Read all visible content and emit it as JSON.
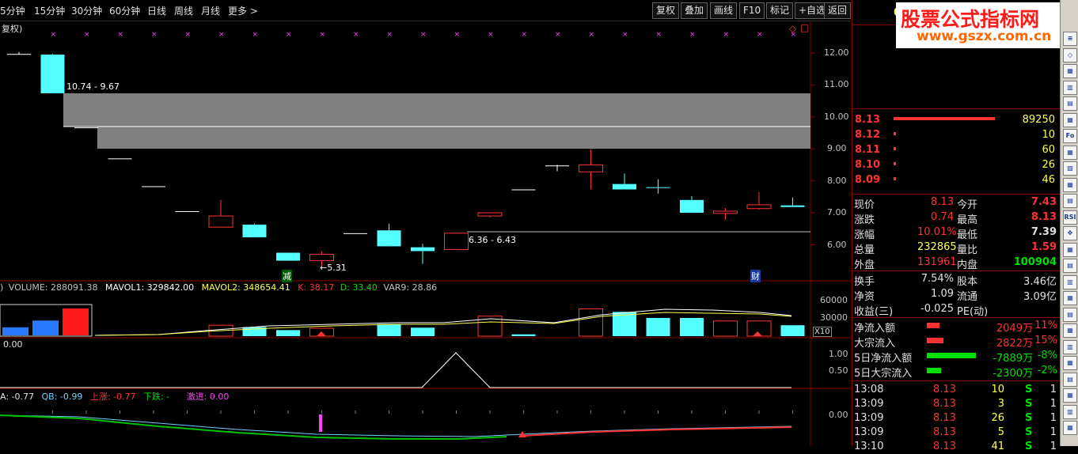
{
  "toolbar": {
    "periods": [
      "5分钟",
      "15分钟",
      "30分钟",
      "60分钟",
      "日线",
      "周线",
      "月线",
      "更多 >"
    ],
    "buttons": [
      "复权",
      "叠加",
      "画线",
      "F10",
      "标记",
      "+自选",
      "返回"
    ]
  },
  "chart": {
    "mode_label": "复权)",
    "price_axis": [
      "12.00",
      "11.00",
      "10.00",
      "9.00",
      "8.00",
      "7.00",
      "6.00"
    ],
    "annotations": {
      "zone_top": "10.74 - 9.67",
      "zone_low": "6.36 - 6.43",
      "low_mark": "←5.31",
      "tag_jian": "减",
      "tag_cai": "财"
    },
    "colors": {
      "up": "#ff3232",
      "down": "#54ffff",
      "zone": "#808080"
    },
    "candles": [
      {
        "o": 11.97,
        "c": 11.97,
        "h": 12.03,
        "l": 11.95
      },
      {
        "o": 11.95,
        "c": 10.74,
        "h": 11.97,
        "l": 10.74
      },
      {
        "o": 9.67,
        "c": 9.67,
        "h": 9.67,
        "l": 9.67
      },
      {
        "o": 8.7,
        "c": 8.7,
        "h": 8.7,
        "l": 8.7
      },
      {
        "o": 7.83,
        "c": 7.83,
        "h": 7.83,
        "l": 7.83
      },
      {
        "o": 7.05,
        "c": 7.05,
        "h": 7.05,
        "l": 7.05
      },
      {
        "o": 6.55,
        "c": 6.9,
        "h": 7.4,
        "l": 6.55
      },
      {
        "o": 6.63,
        "c": 6.23,
        "h": 6.66,
        "l": 6.23
      },
      {
        "o": 5.75,
        "c": 5.5,
        "h": 5.75,
        "l": 5.5
      },
      {
        "o": 5.5,
        "c": 5.7,
        "h": 5.8,
        "l": 5.31
      },
      {
        "o": 6.36,
        "c": 6.36,
        "h": 6.36,
        "l": 6.36
      },
      {
        "o": 6.45,
        "c": 5.95,
        "h": 6.66,
        "l": 5.95
      },
      {
        "o": 5.92,
        "c": 5.8,
        "h": 6.03,
        "l": 5.4
      },
      {
        "o": 5.85,
        "c": 6.36,
        "h": 6.36,
        "l": 5.85
      },
      {
        "o": 6.9,
        "c": 7.0,
        "h": 7.0,
        "l": 6.85
      },
      {
        "o": 7.73,
        "c": 7.73,
        "h": 7.73,
        "l": 7.73
      },
      {
        "o": 8.48,
        "c": 8.48,
        "h": 8.5,
        "l": 8.3
      },
      {
        "o": 8.28,
        "c": 8.5,
        "h": 8.98,
        "l": 7.73
      },
      {
        "o": 7.9,
        "c": 7.73,
        "h": 8.23,
        "l": 7.73
      },
      {
        "o": 7.8,
        "c": 7.78,
        "h": 8.05,
        "l": 7.6
      },
      {
        "o": 7.4,
        "c": 7.0,
        "h": 7.52,
        "l": 7.0
      },
      {
        "o": 6.98,
        "c": 7.05,
        "h": 7.15,
        "l": 6.78
      },
      {
        "o": 7.13,
        "c": 7.25,
        "h": 7.65,
        "l": 7.1
      },
      {
        "o": 7.23,
        "c": 7.18,
        "h": 7.48,
        "l": 7.18
      }
    ]
  },
  "volume": {
    "header": {
      "prefix": ")",
      "vol": "VOLUME: 288091.38",
      "mavol1": "MAVOL1: 329842.00",
      "mavol2": "MAVOL2: 348654.41",
      "k": "K: 38.17",
      "d": "D: 33.40",
      "var9": "VAR9: 28.86"
    },
    "axis": [
      "60000",
      "30000"
    ],
    "x10": "X10",
    "bars": [
      0,
      0,
      0,
      0,
      0,
      0,
      18000,
      15000,
      10000,
      13000,
      0,
      20000,
      14000,
      0,
      33000,
      3000,
      0,
      45000,
      40000,
      30000,
      30000,
      25000,
      25000,
      18000
    ],
    "inset": [
      {
        "v": 0.3,
        "up": false
      },
      {
        "v": 0.55,
        "up": false
      },
      {
        "v": 1.0,
        "up": true
      }
    ]
  },
  "osc": {
    "value_label": "0.00",
    "axis": [
      "1.00",
      "0.50"
    ]
  },
  "bottom": {
    "labels": {
      "a": "A: -0.77",
      "qb": "QB: -0.99",
      "up": "上涨: -0.77",
      "down": "下跌: -",
      "aggr": "激进: 0.00"
    },
    "axis": "0.00"
  },
  "quote": {
    "top_code": "0",
    "order_book": [
      {
        "price": "8.13",
        "vol": "89250",
        "bar": 1.0
      },
      {
        "price": "8.12",
        "vol": "10",
        "bar": 0.02
      },
      {
        "price": "8.11",
        "vol": "60",
        "bar": 0.02
      },
      {
        "price": "8.10",
        "vol": "26",
        "bar": 0.02
      },
      {
        "price": "8.09",
        "vol": "46",
        "bar": 0.02
      }
    ],
    "stats": [
      {
        "l1": "现价",
        "v1": "8.13",
        "c1": "#ff3232",
        "l2": "今开",
        "v2": "7.43",
        "c2": "#ff3232"
      },
      {
        "l1": "涨跌",
        "v1": "0.74",
        "c1": "#ff3232",
        "l2": "最高",
        "v2": "8.13",
        "c2": "#ff3232"
      },
      {
        "l1": "涨幅",
        "v1": "10.01%",
        "c1": "#ff3232",
        "l2": "最低",
        "v2": "7.39",
        "c2": "#e0e0e0"
      },
      {
        "l1": "总量",
        "v1": "232865",
        "c1": "#ffff54",
        "l2": "量比",
        "v2": "1.59",
        "c2": "#ff3232"
      },
      {
        "l1": "外盘",
        "v1": "131961",
        "c1": "#ff3232",
        "l2": "内盘",
        "v2": "100904",
        "c2": "#00e000"
      }
    ],
    "stats2": [
      {
        "l1": "换手",
        "v1": "7.54%",
        "l2": "股本",
        "v2": "3.46亿"
      },
      {
        "l1": "净资",
        "v1": "1.09",
        "l2": "流通",
        "v2": "3.09亿"
      },
      {
        "l1": "收益(三)",
        "v1": "-0.025",
        "l2": "PE(动)",
        "v2": ""
      }
    ],
    "flows": [
      {
        "label": "净流入额",
        "value": "2049万",
        "pct": "11%",
        "color": "#ff3232",
        "bar": 0.25
      },
      {
        "label": "大宗流入",
        "value": "2822万",
        "pct": "15%",
        "color": "#ff3232",
        "bar": 0.34
      },
      {
        "label": "5日净流入额",
        "value": "-7889万",
        "pct": "-8%",
        "color": "#00e000",
        "bar": 1.0
      },
      {
        "label": "5日大宗流入",
        "value": "-2300万",
        "pct": "-2%",
        "color": "#00e000",
        "bar": 0.29
      }
    ],
    "ticks": [
      {
        "time": "13:08",
        "price": "8.13",
        "vol": "10",
        "side": "S",
        "n": "1"
      },
      {
        "time": "13:09",
        "price": "8.13",
        "vol": "3",
        "side": "S",
        "n": "1"
      },
      {
        "time": "13:09",
        "price": "8.13",
        "vol": "26",
        "side": "S",
        "n": "1"
      },
      {
        "time": "13:09",
        "price": "8.13",
        "vol": "5",
        "side": "S",
        "n": "1"
      },
      {
        "time": "13:10",
        "price": "8.13",
        "vol": "41",
        "side": "S",
        "n": "1"
      }
    ]
  },
  "logo": {
    "line1": "股票公式指标网",
    "line2": "www.gszx.com.cn"
  },
  "sidebar_icons": [
    "≡",
    "◇",
    "▦",
    "▥",
    "▤",
    "▦",
    "Fo",
    "▦",
    "▧",
    "▦",
    "▤",
    "RSI",
    "✥",
    "▦",
    "▤",
    "▥",
    "▦",
    "▤",
    "▦",
    "▥",
    "▦",
    "▤",
    "▦",
    "▥",
    "▦"
  ]
}
